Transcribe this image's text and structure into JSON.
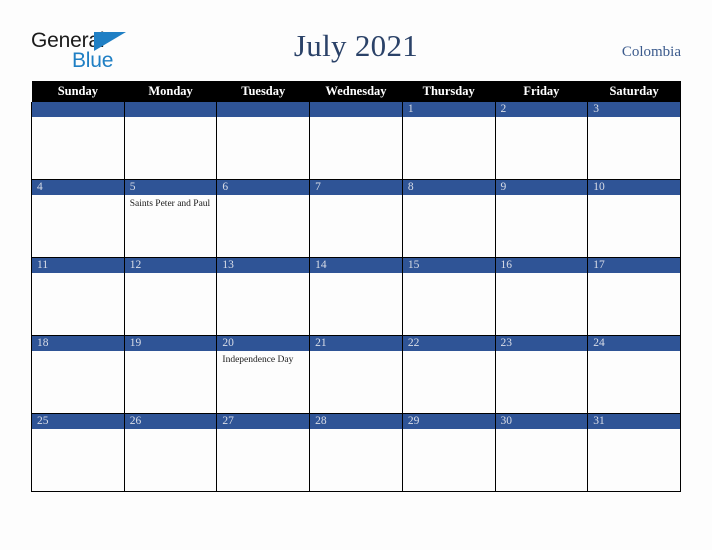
{
  "brand": {
    "word1": "General",
    "word2": "Blue",
    "triangle_color": "#1f7fc4",
    "word1_color": "#1b1b1b",
    "word2_color": "#1f7fc4"
  },
  "header": {
    "title": "July 2021",
    "title_color": "#2b4268",
    "country": "Colombia",
    "country_color": "#3b5a8c"
  },
  "calendar": {
    "weekday_headers": [
      "Sunday",
      "Monday",
      "Tuesday",
      "Wednesday",
      "Thursday",
      "Friday",
      "Saturday"
    ],
    "header_bg": "#000000",
    "header_text_color": "#ffffff",
    "datebar_bg": "#2f5496",
    "datebar_text_color": "#d9dde7",
    "cell_bg": "#fdfdfd",
    "grid_line_color": "#000000",
    "weeks": [
      [
        {
          "date": "",
          "events": ""
        },
        {
          "date": "",
          "events": ""
        },
        {
          "date": "",
          "events": ""
        },
        {
          "date": "",
          "events": ""
        },
        {
          "date": "1",
          "events": ""
        },
        {
          "date": "2",
          "events": ""
        },
        {
          "date": "3",
          "events": ""
        }
      ],
      [
        {
          "date": "4",
          "events": ""
        },
        {
          "date": "5",
          "events": "Saints Peter and Paul"
        },
        {
          "date": "6",
          "events": ""
        },
        {
          "date": "7",
          "events": ""
        },
        {
          "date": "8",
          "events": ""
        },
        {
          "date": "9",
          "events": ""
        },
        {
          "date": "10",
          "events": ""
        }
      ],
      [
        {
          "date": "11",
          "events": ""
        },
        {
          "date": "12",
          "events": ""
        },
        {
          "date": "13",
          "events": ""
        },
        {
          "date": "14",
          "events": ""
        },
        {
          "date": "15",
          "events": ""
        },
        {
          "date": "16",
          "events": ""
        },
        {
          "date": "17",
          "events": ""
        }
      ],
      [
        {
          "date": "18",
          "events": ""
        },
        {
          "date": "19",
          "events": ""
        },
        {
          "date": "20",
          "events": "Independence Day"
        },
        {
          "date": "21",
          "events": ""
        },
        {
          "date": "22",
          "events": ""
        },
        {
          "date": "23",
          "events": ""
        },
        {
          "date": "24",
          "events": ""
        }
      ],
      [
        {
          "date": "25",
          "events": ""
        },
        {
          "date": "26",
          "events": ""
        },
        {
          "date": "27",
          "events": ""
        },
        {
          "date": "28",
          "events": ""
        },
        {
          "date": "29",
          "events": ""
        },
        {
          "date": "30",
          "events": ""
        },
        {
          "date": "31",
          "events": ""
        }
      ]
    ]
  }
}
